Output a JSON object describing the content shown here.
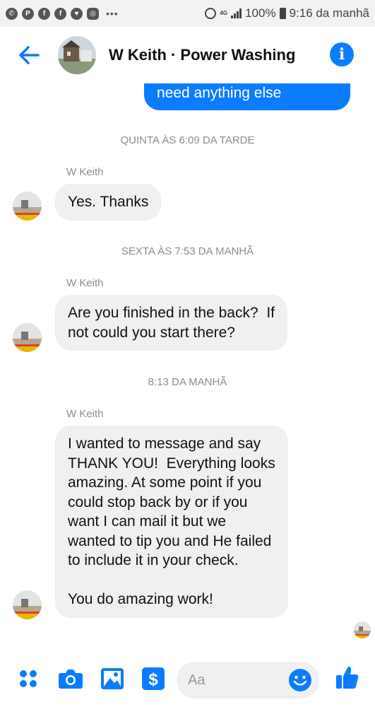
{
  "status_bar": {
    "battery": "100%",
    "time": "9:16 da manhã",
    "network": "4G"
  },
  "header": {
    "title": "W Keith · Power Washing",
    "info_icon": "info-icon",
    "back_icon": "arrow-left-icon"
  },
  "thread": {
    "outgoing_tail": "need anything else",
    "groups": [
      {
        "timestamp": "QUINTA ÀS 6:09 DA TARDE",
        "sender": "W Keith",
        "message": "Yes. Thanks"
      },
      {
        "timestamp": "SEXTA ÀS 7:53 DA MANHÃ",
        "sender": "W Keith",
        "message": "Are you finished in the back?  If\nnot could you start there?"
      },
      {
        "timestamp": "8:13 DA MANHÃ",
        "sender": "W Keith",
        "message": "I wanted to message and say\nTHANK YOU!  Everything looks\namazing. At some point if you\ncould stop back by or if you\nwant I can mail it but we\nwanted to tip you and He failed\nto include it in your check.\n\nYou do amazing work!"
      }
    ]
  },
  "composer": {
    "placeholder": "Aa",
    "icons": [
      "apps-icon",
      "camera-icon",
      "gallery-icon",
      "payment-icon",
      "emoji-icon",
      "thumbs-up-icon"
    ]
  },
  "colors": {
    "accent": "#0a7cff",
    "bubble_in": "#f0f0f0",
    "meta_text": "#8a8d91"
  }
}
